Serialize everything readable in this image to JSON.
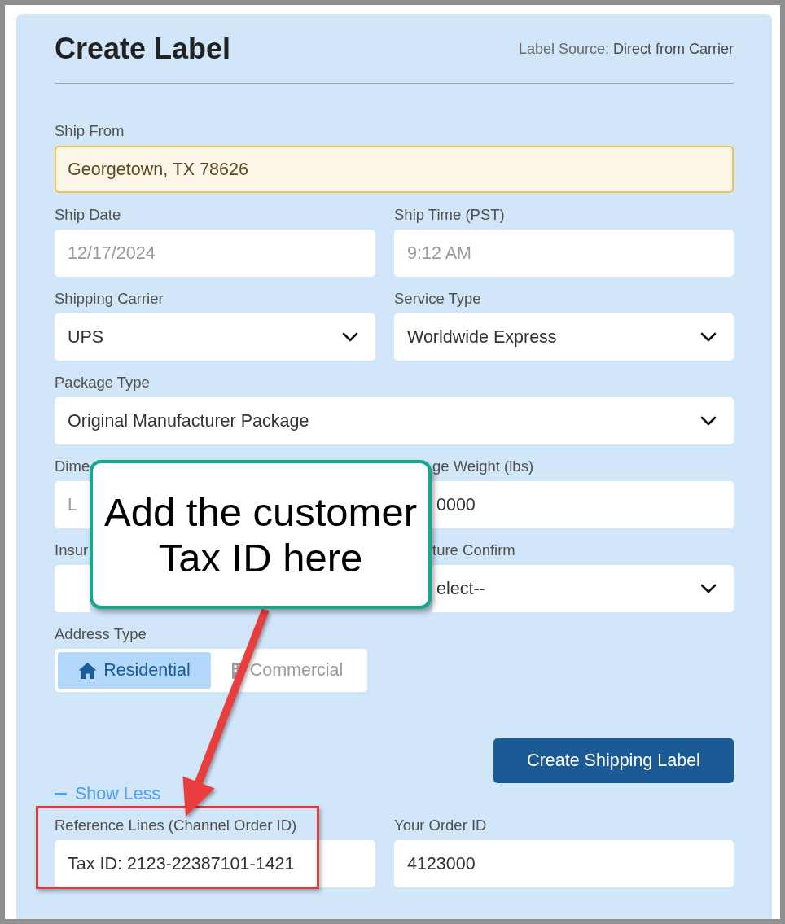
{
  "header": {
    "title": "Create Label",
    "source_label": "Label Source:",
    "source_value": "Direct from Carrier"
  },
  "rows": [
    [
      {
        "kind": "input",
        "label": "Ship From",
        "value": "Georgetown, TX 78626",
        "highlighted": true
      }
    ],
    [
      {
        "kind": "input",
        "label": "Ship Date",
        "placeholder": "12/17/2024",
        "highlighted": false
      },
      {
        "kind": "input",
        "label": "Ship Time (PST)",
        "placeholder": "9:12 AM",
        "highlighted": false
      }
    ],
    [
      {
        "kind": "select",
        "label": "Shipping Carrier",
        "value": "UPS",
        "highlighted": false
      },
      {
        "kind": "select",
        "label": "Service Type",
        "value": "Worldwide Express",
        "highlighted": false
      }
    ],
    [
      {
        "kind": "select",
        "label": "Package Type",
        "value": "Original Manufacturer Package",
        "highlighted": false
      }
    ],
    [
      {
        "kind": "input",
        "label": "Dime",
        "placeholder": "L",
        "highlighted": false
      },
      {
        "kind": "input",
        "label": "ge Weight (lbs)",
        "value": "0000",
        "highlighted": false
      }
    ],
    [
      {
        "kind": "input",
        "label": "Insur",
        "highlighted": false
      },
      {
        "kind": "select",
        "label": "ture Confirm",
        "value": "elect--",
        "highlighted": false
      }
    ],
    [
      {
        "kind": "segmented",
        "label": "Address Type",
        "options": [
          {
            "label": "Residential",
            "selected": true
          },
          {
            "label": "Commercial",
            "selected": false
          }
        ]
      }
    ]
  ],
  "create_button": "Create Shipping Label",
  "toggle_link": "Show Less",
  "reference_fields": [
    {
      "kind": "input",
      "label": "Reference Lines (Channel Order ID)",
      "value": "Tax ID: 2123-22387101-1421",
      "highlighted": false
    },
    {
      "kind": "input",
      "label": "Your Order ID",
      "value": "4123000",
      "highlighted": false
    }
  ],
  "annotation": {
    "callout": "Add the customer Tax ID here"
  }
}
